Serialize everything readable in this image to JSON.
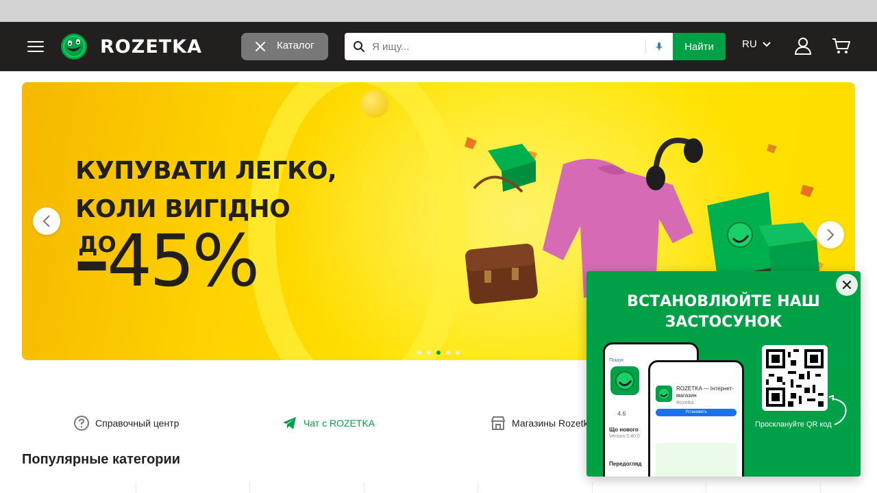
{
  "header": {
    "logo_text": "ROZETKA",
    "catalog_label": "Каталог",
    "search": {
      "placeholder": "Я ищу...",
      "button_label": "Найти"
    },
    "language": "RU",
    "colors": {
      "header_bg": "#221f1f",
      "accent": "#00a046",
      "catalog_btn": "#797878"
    }
  },
  "banner": {
    "headline_line1": "КУПУВАТИ ЛЕГКО,",
    "headline_line2": "КОЛИ ВИГІДНО",
    "upto": "ДО",
    "discount": "45%",
    "minus": "–",
    "carousel_dots": 5,
    "active_dot": 3
  },
  "links": {
    "help": "Справочный центр",
    "chat": "Чат с ROZETKA",
    "stores": "Магазины Rozetka"
  },
  "popular": {
    "title": "Популярные категории"
  },
  "app_popup": {
    "title_line1": "ВСТАНОВЛЮЙТЕ НАШ",
    "title_line2": "ЗАСТОСУНОК",
    "qr_caption": "Просклануйте QR код",
    "phone_back": {
      "back_label": "Пошук",
      "rating": "4.6",
      "whats_new": "Що нового",
      "version": "Version 5.40.0",
      "preview": "Передогляд"
    },
    "phone_front": {
      "app_name": "ROZETKA — Інтернет-магазин",
      "publisher": "Rozetka",
      "install": "Установить"
    }
  }
}
